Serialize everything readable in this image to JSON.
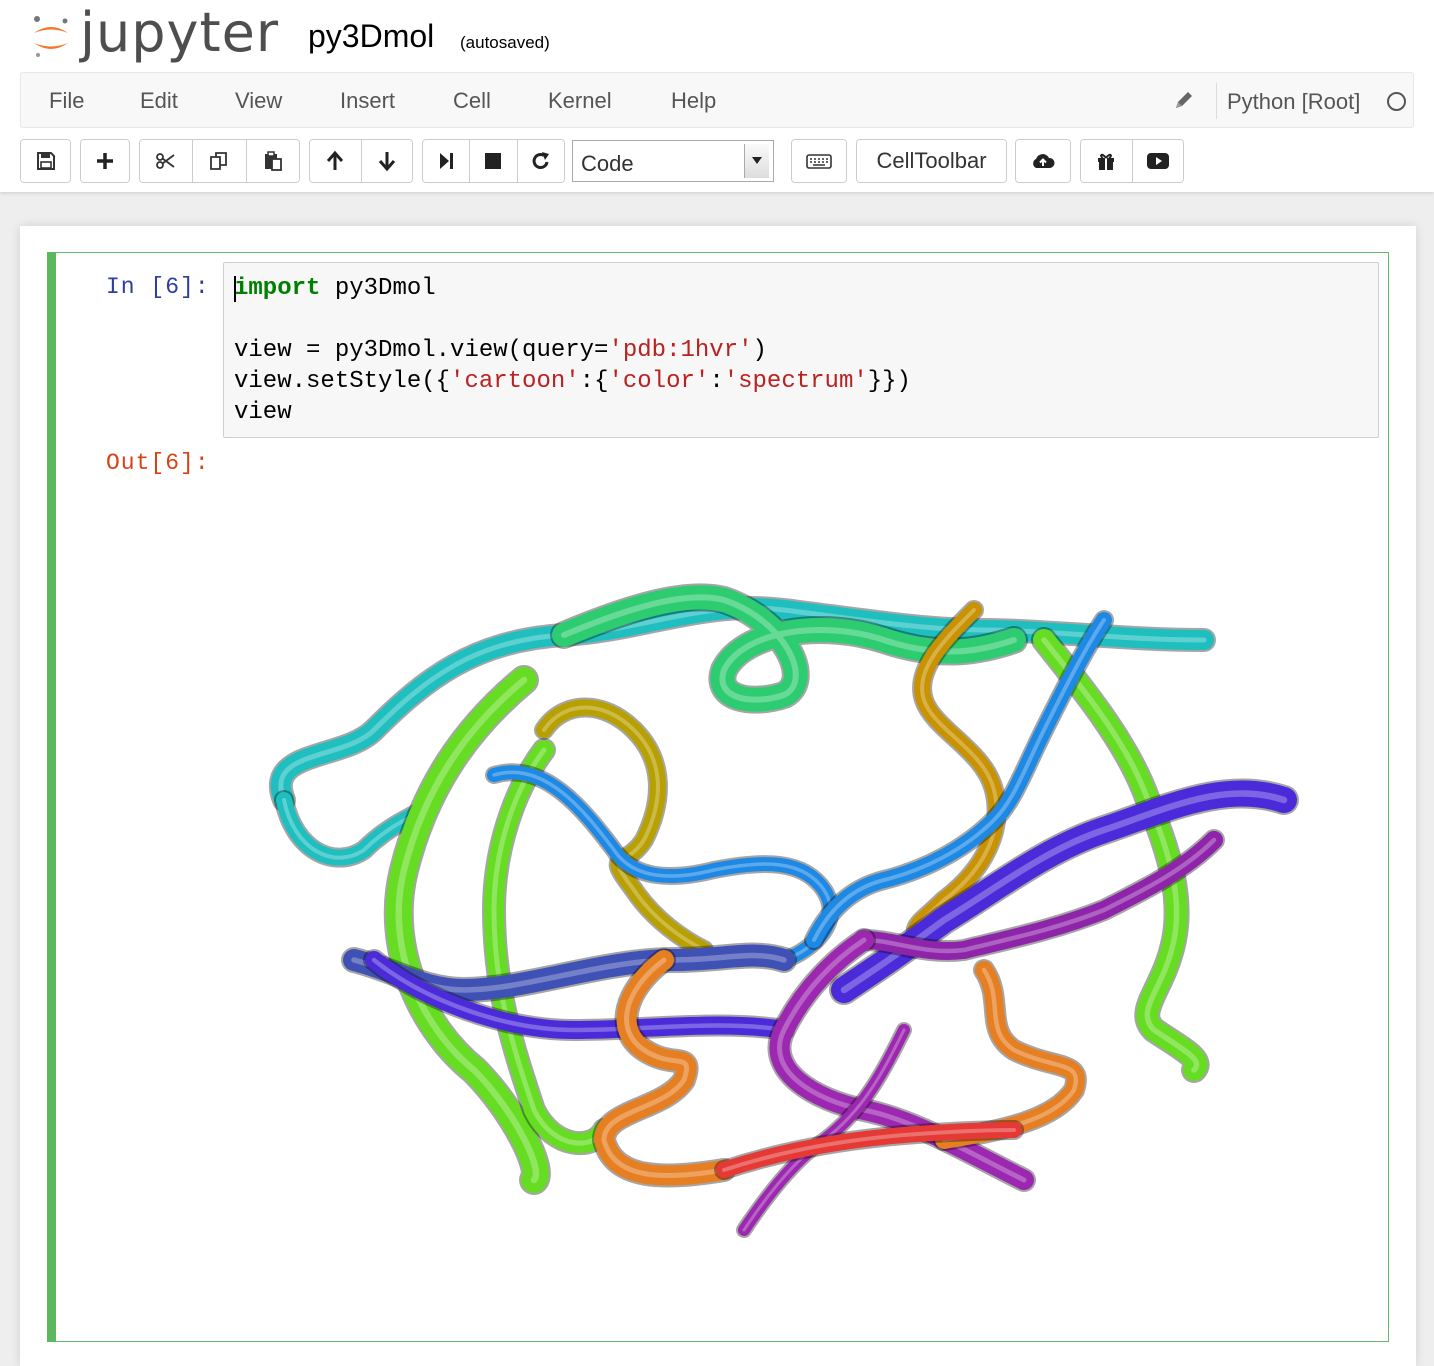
{
  "header": {
    "logo_text": "jupyter",
    "notebook_name": "py3Dmol",
    "save_status": "(autosaved)"
  },
  "menu": {
    "items": [
      "File",
      "Edit",
      "View",
      "Insert",
      "Cell",
      "Kernel",
      "Help"
    ],
    "kernel_name": "Python [Root]"
  },
  "toolbar": {
    "cell_type": "Code",
    "celltoolbar_label": "CellToolbar",
    "buttons": [
      "save-icon",
      "plus-icon",
      "cut-icon",
      "copy-icon",
      "paste-icon",
      "arrow-up-icon",
      "arrow-down-icon",
      "step-forward-icon",
      "stop-icon",
      "refresh-icon",
      "keyboard-icon",
      "cloud-upload-icon",
      "gift-icon",
      "youtube-play-icon"
    ]
  },
  "cell": {
    "in_prompt": "In [6]:",
    "out_prompt": "Out[6]:",
    "code_lines": [
      "import py3Dmol",
      "",
      "view = py3Dmol.view(query='pdb:1hvr')",
      "view.setStyle({'cartoon':{'color':'spectrum'}})",
      "view"
    ]
  },
  "viewer": {
    "structure": "pdb:1hvr",
    "style": "cartoon",
    "color_scheme": "spectrum",
    "colors": [
      "#1fbfbf",
      "#2ecc71",
      "#66dd22",
      "#9acd32",
      "#b8a000",
      "#c89200",
      "#1e88e5",
      "#3f51b5",
      "#4b2bd9",
      "#8e24aa",
      "#e67e22",
      "#e53935",
      "#9c27b0"
    ]
  }
}
